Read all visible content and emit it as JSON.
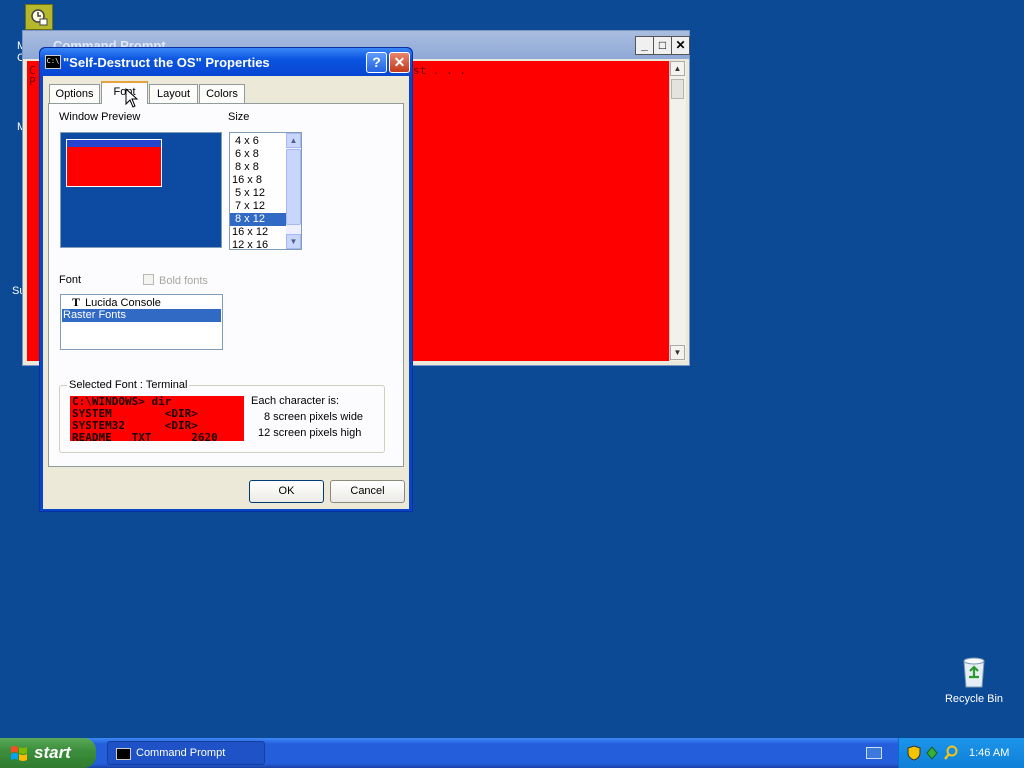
{
  "desktop": {
    "fragments": [
      "M",
      "C",
      "M",
      "Su"
    ],
    "recycle_bin_label": "Recycle Bin"
  },
  "cmd_window": {
    "title": "Command Prompt",
    "visible_text_line1": "C",
    "visible_text_line1_tail": "st . . .",
    "visible_text_line2": "P",
    "minimize": "_",
    "maximize": "□",
    "close": "✕",
    "scroll_up": "▲",
    "scroll_down": "▼"
  },
  "dialog": {
    "icon_text": "C:\\",
    "title": "\"Self-Destruct the OS\" Properties",
    "help_button": "?",
    "close_button": "✕",
    "tabs": [
      {
        "label": "Options"
      },
      {
        "label": "Font"
      },
      {
        "label": "Layout"
      },
      {
        "label": "Colors"
      }
    ],
    "selected_tab": "Font",
    "window_preview_label": "Window Preview",
    "size_label": "Size",
    "sizes": [
      "4 x 6",
      "6 x 8",
      "8 x 8",
      "16 x 8",
      "5 x 12",
      "7 x 12",
      "8 x 12",
      "16 x 12",
      "12 x 16"
    ],
    "selected_size": "8 x 12",
    "scroll_up": "▲",
    "scroll_down": "▼",
    "font_label": "Font",
    "bold_fonts_label": "Bold fonts",
    "font_glyph": "T",
    "fonts": [
      "Lucida Console",
      "Raster Fonts"
    ],
    "selected_font": "Raster Fonts",
    "selected_font_group_label": "Selected Font : Terminal",
    "sample_lines": [
      "C:\\WINDOWS> dir",
      "SYSTEM        <DIR>",
      "SYSTEM32      <DIR>",
      "README   TXT      2620"
    ],
    "char_info_heading": "Each character is:",
    "char_width_text": "8 screen pixels wide",
    "char_height_text": "12 screen pixels high",
    "ok_label": "OK",
    "cancel_label": "Cancel"
  },
  "taskbar": {
    "start_label": "start",
    "task_button_label": "Command Prompt",
    "clock": "1:46 AM"
  },
  "colors": {
    "desktop_bg": "#0d4a96",
    "console_bg": "#ff0000",
    "selection": "#316ac5"
  }
}
